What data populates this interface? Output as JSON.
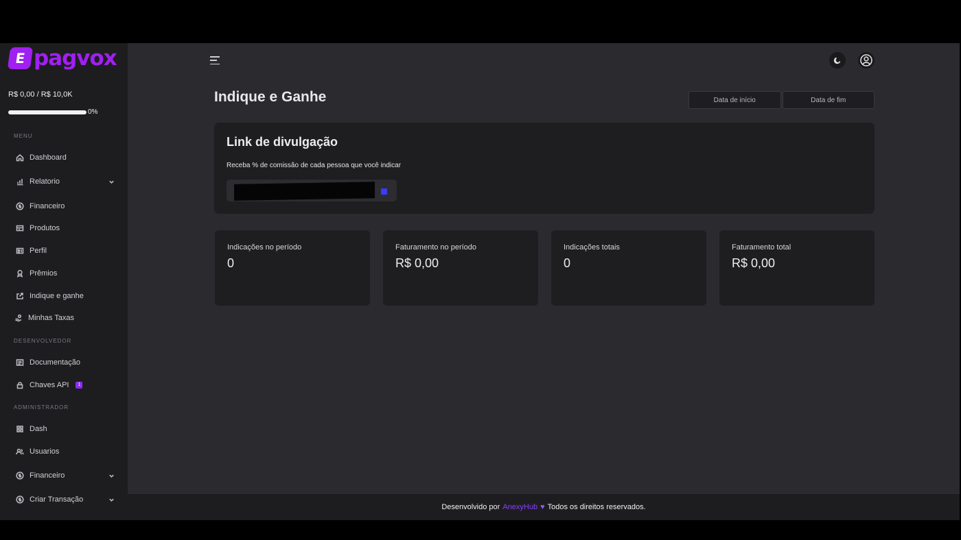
{
  "brand": {
    "logo_mark": "E",
    "logo_text": "pagvox"
  },
  "balance": {
    "text": "R$ 0,00 / R$ 10,0K",
    "progress_pct": 0,
    "progress_label": "0%"
  },
  "sidebar": {
    "menu_header": "MENU",
    "menu_items": [
      {
        "label": "Dashboard",
        "icon": "home-icon"
      },
      {
        "label": "Relatorio",
        "icon": "bar-chart-icon",
        "expandable": true
      },
      {
        "label": "Financeiro",
        "icon": "dollar-circle-icon"
      },
      {
        "label": "Produtos",
        "icon": "box-icon"
      },
      {
        "label": "Perfil",
        "icon": "id-card-icon"
      },
      {
        "label": "Prêmios",
        "icon": "award-icon"
      },
      {
        "label": "Indique e ganhe",
        "icon": "share-icon"
      },
      {
        "label": "Minhas Taxas",
        "icon": "hand-coins-icon"
      }
    ],
    "dev_header": "DESENVOLVEDOR",
    "dev_items": [
      {
        "label": "Documentação",
        "icon": "document-icon"
      },
      {
        "label": "Chaves API",
        "icon": "lock-icon",
        "badge": "1"
      }
    ],
    "admin_header": "ADMINISTRADOR",
    "admin_items": [
      {
        "label": "Dash",
        "icon": "grid-icon"
      },
      {
        "label": "Usuarios",
        "icon": "users-icon"
      },
      {
        "label": "Financeiro",
        "icon": "dollar-circle-icon",
        "expandable": true
      },
      {
        "label": "Criar Transação",
        "icon": "dollar-circle-icon",
        "expandable": true
      }
    ]
  },
  "header": {
    "menu_icon": "hamburger-icon",
    "theme_icon": "moon-icon",
    "user_icon": "user-circle-icon"
  },
  "page": {
    "title": "Indique e Ganhe",
    "date_start": "Data de início",
    "date_end": "Data de fim"
  },
  "link_card": {
    "title": "Link de divulgação",
    "description": "Receba % de comissão de cada pessoa que você indicar",
    "copy_icon": "copy-icon"
  },
  "stats": [
    {
      "label": "Indicações no período",
      "value": "0"
    },
    {
      "label": "Faturamento no período",
      "value": "R$ 0,00"
    },
    {
      "label": "Indicações totais",
      "value": "0"
    },
    {
      "label": "Faturamento total",
      "value": "R$ 0,00"
    }
  ],
  "footer": {
    "prefix": "Desenvolvido por",
    "brand": "AnexyHub",
    "heart": "♥",
    "suffix": "Todos os direitos reservados."
  },
  "colors": {
    "accent": "#a020f0",
    "brand_link": "#8b3dff",
    "sidebar_bg": "#1d1d20",
    "main_bg": "#2b2b2f",
    "card_bg": "#1e1e21"
  }
}
